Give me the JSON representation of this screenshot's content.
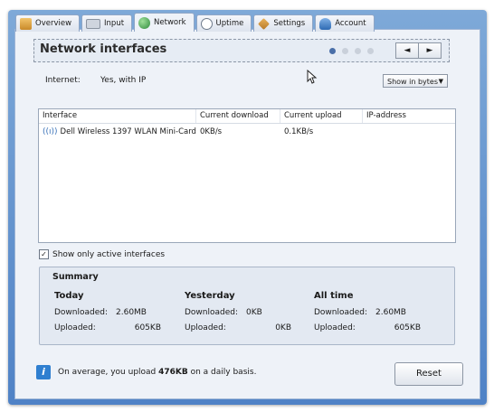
{
  "tabs": [
    {
      "label": "Overview",
      "icon": "home-icon"
    },
    {
      "label": "Input",
      "icon": "keyboard-icon"
    },
    {
      "label": "Network",
      "icon": "globe-icon",
      "active": true
    },
    {
      "label": "Uptime",
      "icon": "clock-icon"
    },
    {
      "label": "Settings",
      "icon": "wrench-icon"
    },
    {
      "label": "Account",
      "icon": "user-icon"
    }
  ],
  "header": {
    "title": "Network interfaces",
    "pages": 4,
    "current_page": 1,
    "prev": "◄",
    "next": "►"
  },
  "internet": {
    "label": "Internet:",
    "value": "Yes, with IP"
  },
  "unit_select": {
    "value": "Show in bytes"
  },
  "table": {
    "columns": [
      "Interface",
      "Current download",
      "Current upload",
      "IP-address"
    ],
    "rows": [
      {
        "interface": "Dell Wireless 1397 WLAN Mini-Card",
        "download": "0KB/s",
        "upload": "0.1KB/s",
        "ip": ""
      }
    ]
  },
  "active_only": {
    "label": "Show only active interfaces",
    "checked": true
  },
  "summary": {
    "title": "Summary",
    "columns": [
      {
        "heading": "Today",
        "downloaded_label": "Downloaded:",
        "downloaded": "2.60MB",
        "uploaded_label": "Uploaded:",
        "uploaded": "605KB"
      },
      {
        "heading": "Yesterday",
        "downloaded_label": "Downloaded:",
        "downloaded": "0KB",
        "uploaded_label": "Uploaded:",
        "uploaded": "0KB"
      },
      {
        "heading": "All time",
        "downloaded_label": "Downloaded:",
        "downloaded": "2.60MB",
        "uploaded_label": "Uploaded:",
        "uploaded": "605KB"
      }
    ]
  },
  "footer": {
    "info_pre": "On average, you upload ",
    "info_bold": "476KB",
    "info_post": " on a daily basis.",
    "reset": "Reset"
  },
  "colors": {
    "frame": "#5f8fcf",
    "accent": "#2f7fd0"
  }
}
